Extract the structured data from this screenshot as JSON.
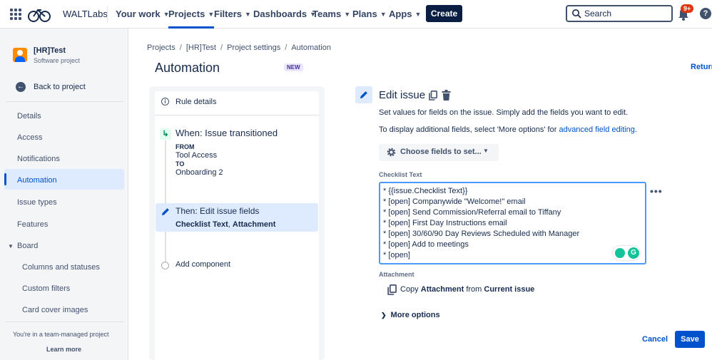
{
  "topnav": {
    "brand": "WALTLabs",
    "items": [
      {
        "label": "Your work"
      },
      {
        "label": "Projects"
      },
      {
        "label": "Filters"
      },
      {
        "label": "Dashboards"
      },
      {
        "label": "Teams"
      },
      {
        "label": "Plans"
      },
      {
        "label": "Apps"
      }
    ],
    "active_item": "Projects",
    "create_label": "Create",
    "search_placeholder": "Search",
    "notification_badge": "9+",
    "help_glyph": "?"
  },
  "sidebar": {
    "project_name": "[HR]Test",
    "project_type": "Software project",
    "back_label": "Back to project",
    "items": [
      "Details",
      "Access",
      "Notifications",
      "Automation",
      "Issue types",
      "Features",
      "Board"
    ],
    "active_item": "Automation",
    "board_subitems": [
      "Columns and statuses",
      "Custom filters",
      "Card cover images"
    ],
    "team_note": "You're in a team-managed project",
    "learn_more": "Learn more"
  },
  "breadcrumb": [
    "Projects",
    "[HR]Test",
    "Project settings",
    "Automation"
  ],
  "page": {
    "title": "Automation",
    "new_badge": "NEW",
    "return_link": "Return"
  },
  "rule": {
    "details_label": "Rule details",
    "trigger": {
      "title": "When: Issue transitioned",
      "from_key": "FROM",
      "from_value": "Tool Access",
      "to_key": "TO",
      "to_value": "Onboarding 2"
    },
    "action": {
      "title": "Then: Edit issue fields",
      "field1": "Checklist Text",
      "separator": ", ",
      "field2": "Attachment"
    },
    "add_component": "Add component"
  },
  "edit_issue": {
    "title": "Edit issue",
    "description": "Set values for fields on the issue. Simply add the fields you want to edit.",
    "more_info_prefix": "To display additional fields, select 'More options' for ",
    "more_info_link": "advanced field editing",
    "more_info_suffix": ".",
    "choose_fields": "Choose fields to set...",
    "checklist_label": "Checklist Text",
    "checklist_lines": [
      "* {{issue.Checklist Text}}",
      "* [open] Companywide \"Welcome!\" email",
      "* [open] Send Commission/Referral email to Tiffany",
      "* [open] First Day Instructions email",
      "* [open] 30/60/90 Day Reviews Scheduled with Manager",
      "* [open] Add to meetings",
      "* [open]"
    ],
    "attachment_label": "Attachment",
    "attachment_prefix": "Copy ",
    "attachment_field": "Attachment",
    "attachment_mid": " from ",
    "attachment_source": "Current issue",
    "more_options": "More options",
    "cancel": "Cancel",
    "save": "Save"
  },
  "colors": {
    "primary": "#0052CC",
    "selected_bg": "#DEEBFF",
    "dark": "#172B4D",
    "badge": "#DE350B",
    "grammarly": "#15C39A"
  }
}
